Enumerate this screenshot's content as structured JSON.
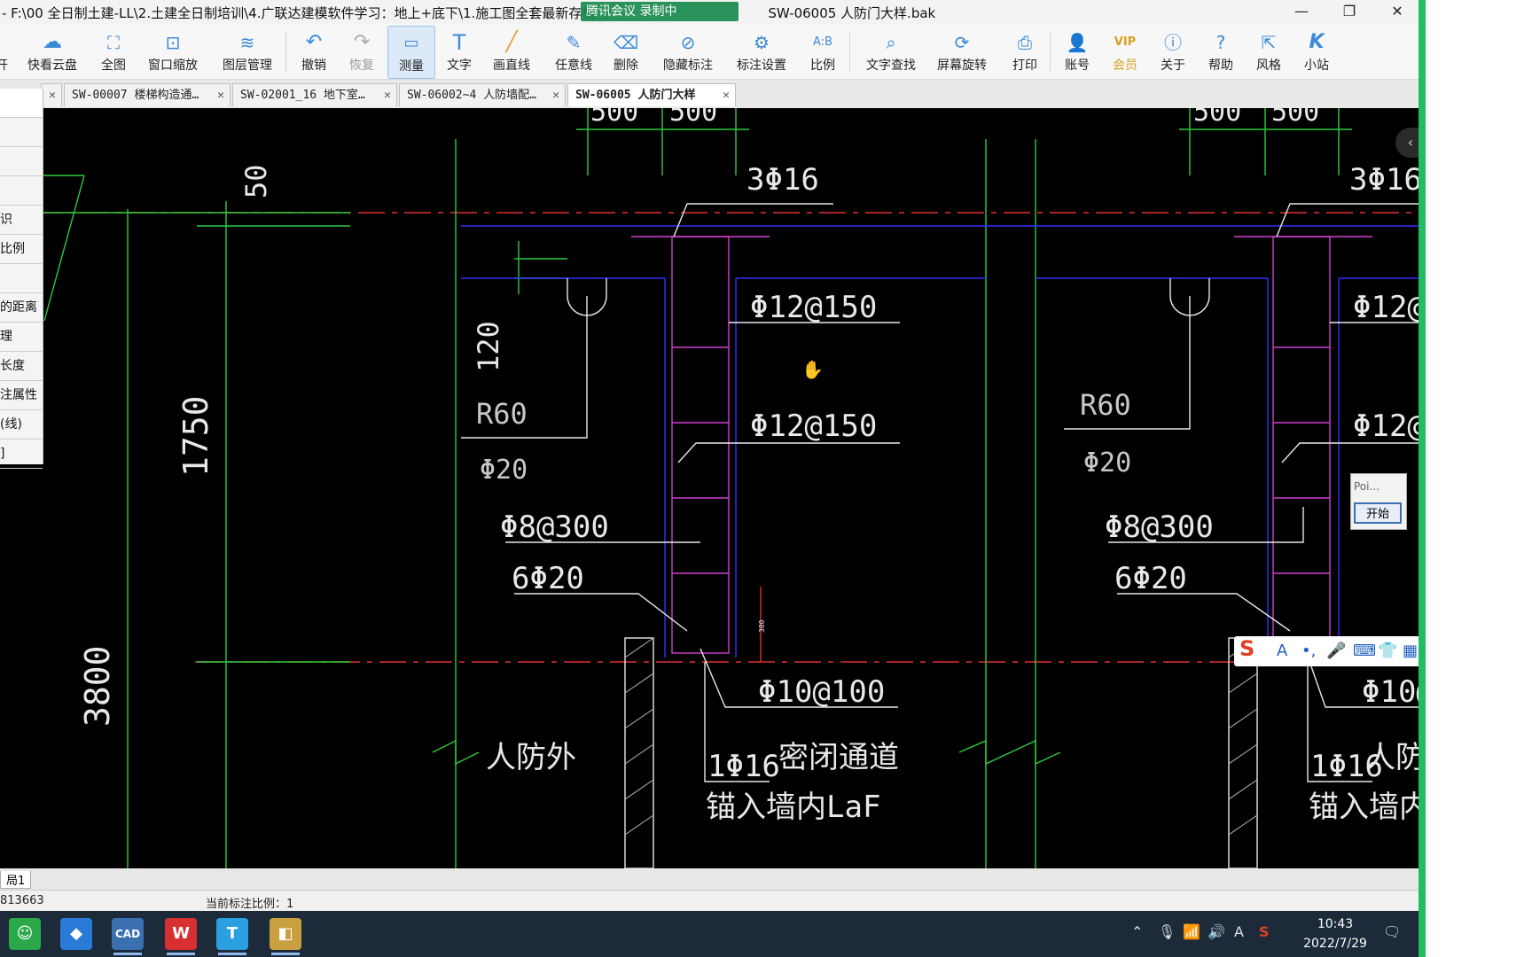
{
  "titlebar": {
    "title": "- F:\\00 全日制土建-LL\\2.土建全日制培训\\4.广联达建模软件学习：地上+底下\\1.施工图全套最新存档（",
    "overlay": "腾讯会议 录制中",
    "title_tail": "SW-06005 人防门大样.bak"
  },
  "toolbar": {
    "items": [
      {
        "label": "开",
        "icon": "folder-icon"
      },
      {
        "label": "快看云盘",
        "icon": "cloud-icon"
      },
      {
        "label": "全图",
        "icon": "fit-all-icon"
      },
      {
        "label": "窗口缩放",
        "icon": "zoom-window-icon"
      },
      {
        "label": "图层管理",
        "icon": "layers-icon"
      },
      {
        "label": "撤销",
        "icon": "undo-icon"
      },
      {
        "label": "恢复",
        "icon": "redo-icon"
      },
      {
        "label": "测量",
        "icon": "measure-icon"
      },
      {
        "label": "文字",
        "icon": "text-icon"
      },
      {
        "label": "画直线",
        "icon": "line-icon"
      },
      {
        "label": "任意线",
        "icon": "freehand-icon"
      },
      {
        "label": "删除",
        "icon": "eraser-icon"
      },
      {
        "label": "隐藏标注",
        "icon": "hide-annotation-icon"
      },
      {
        "label": "标注设置",
        "icon": "annotation-settings-icon"
      },
      {
        "label": "比例",
        "icon": "scale-icon"
      },
      {
        "label": "文字查找",
        "icon": "text-search-icon"
      },
      {
        "label": "屏幕旋转",
        "icon": "rotate-screen-icon"
      },
      {
        "label": "打印",
        "icon": "print-icon"
      },
      {
        "label": "账号",
        "icon": "account-icon"
      },
      {
        "label": "会员",
        "icon": "vip-icon"
      },
      {
        "label": "关于",
        "icon": "info-icon"
      },
      {
        "label": "帮助",
        "icon": "help-icon"
      },
      {
        "label": "风格",
        "icon": "style-icon"
      },
      {
        "label": "小站",
        "icon": "k-station-icon"
      }
    ]
  },
  "tabs": [
    {
      "label": "SW-00007 楼梯构造通…"
    },
    {
      "label": "SW-02001_16 地下室…"
    },
    {
      "label": "SW-06002~4 人防墙配…"
    },
    {
      "label": "SW-06005 人防门大样"
    }
  ],
  "left_panel": {
    "items": [
      "识",
      "比例",
      "",
      "的距离",
      "理",
      "长度",
      "注属性",
      "(线)",
      "]"
    ]
  },
  "drawing": {
    "dims": {
      "d500a": "500",
      "d500b": "500",
      "d50": "50",
      "d120": "120",
      "d1750": "1750",
      "d3800": "3800"
    },
    "labels": {
      "rebar_3phi16": "3Φ16",
      "stirrup_1": "Φ12@150",
      "stirrup_2": "Φ12@150",
      "r60": "R60",
      "phi20": "Φ20",
      "phi8": "Φ8@300",
      "six_phi20": "6Φ20",
      "phi10": "Φ10@100",
      "outside": "人防外",
      "one_phi16": "1Φ16",
      "passage": "密闭通道",
      "anchor": "锚入墙内LaF",
      "inside": "人防内",
      "small_dim": "300"
    },
    "colors": {
      "axis_red": "#e03030",
      "wall_green": "#2ecc40",
      "blue": "#3030ff",
      "magenta": "#d040d0",
      "text": "#e8e8e8"
    }
  },
  "popup": {
    "input_placeholder": "Poi...",
    "start_button": "开始"
  },
  "statusbar": {
    "layout_tab": "局1",
    "coords": "813663",
    "scale_text": "当前标注比例：1"
  },
  "taskbar": {
    "apps": [
      {
        "name": "wechat",
        "glyph": "☺"
      },
      {
        "name": "lanxin",
        "glyph": "◆"
      },
      {
        "name": "cad",
        "glyph": "CAD"
      },
      {
        "name": "wps",
        "glyph": "W"
      },
      {
        "name": "tencent",
        "glyph": "T"
      },
      {
        "name": "paint",
        "glyph": "◧"
      }
    ],
    "time": "10:43",
    "date": "2022/7/29",
    "tray_lang": "A"
  }
}
